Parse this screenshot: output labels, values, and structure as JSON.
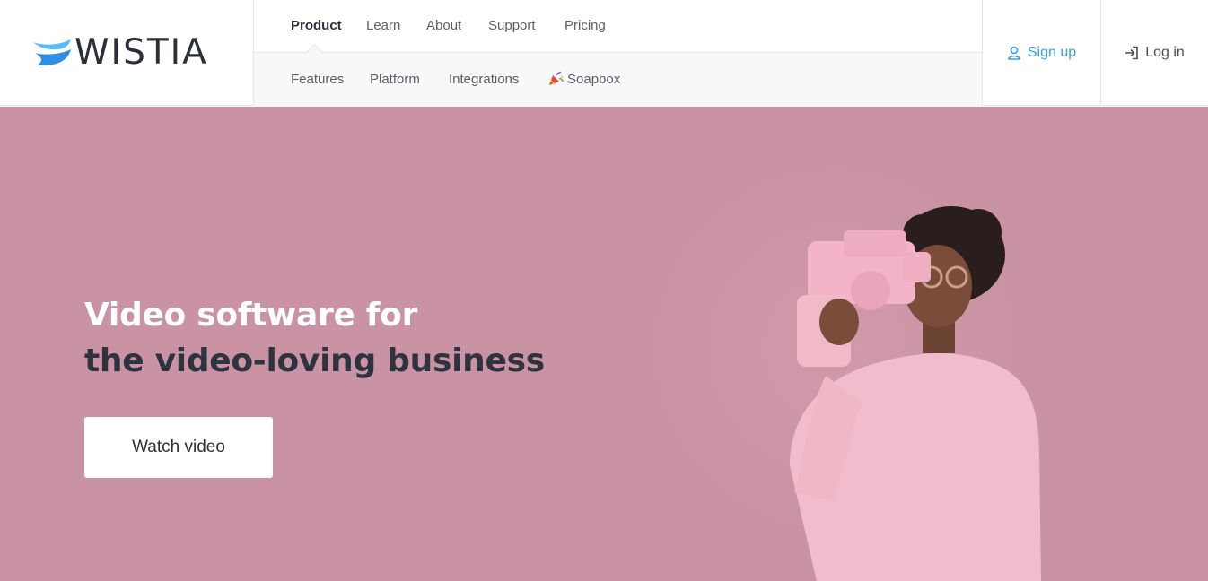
{
  "brand": {
    "name": "WISTIA"
  },
  "nav": {
    "primary": [
      "Product",
      "Learn",
      "About",
      "Support",
      "Pricing"
    ],
    "active": "Product",
    "secondary": [
      "Features",
      "Platform",
      "Integrations",
      "Soapbox"
    ]
  },
  "auth": {
    "signup": "Sign up",
    "login": "Log in"
  },
  "hero": {
    "headline_line1": "Video software for",
    "headline_line2": "the video-loving business",
    "cta": "Watch video"
  },
  "colors": {
    "hero_bg": "#c993a4",
    "accent_blue": "#3a9de0",
    "text_dark": "#2b2f3b"
  },
  "icons": {
    "logo": "wistia-wave-icon",
    "soapbox": "party-popper-icon",
    "signup": "user-icon",
    "login": "log-in-icon"
  }
}
